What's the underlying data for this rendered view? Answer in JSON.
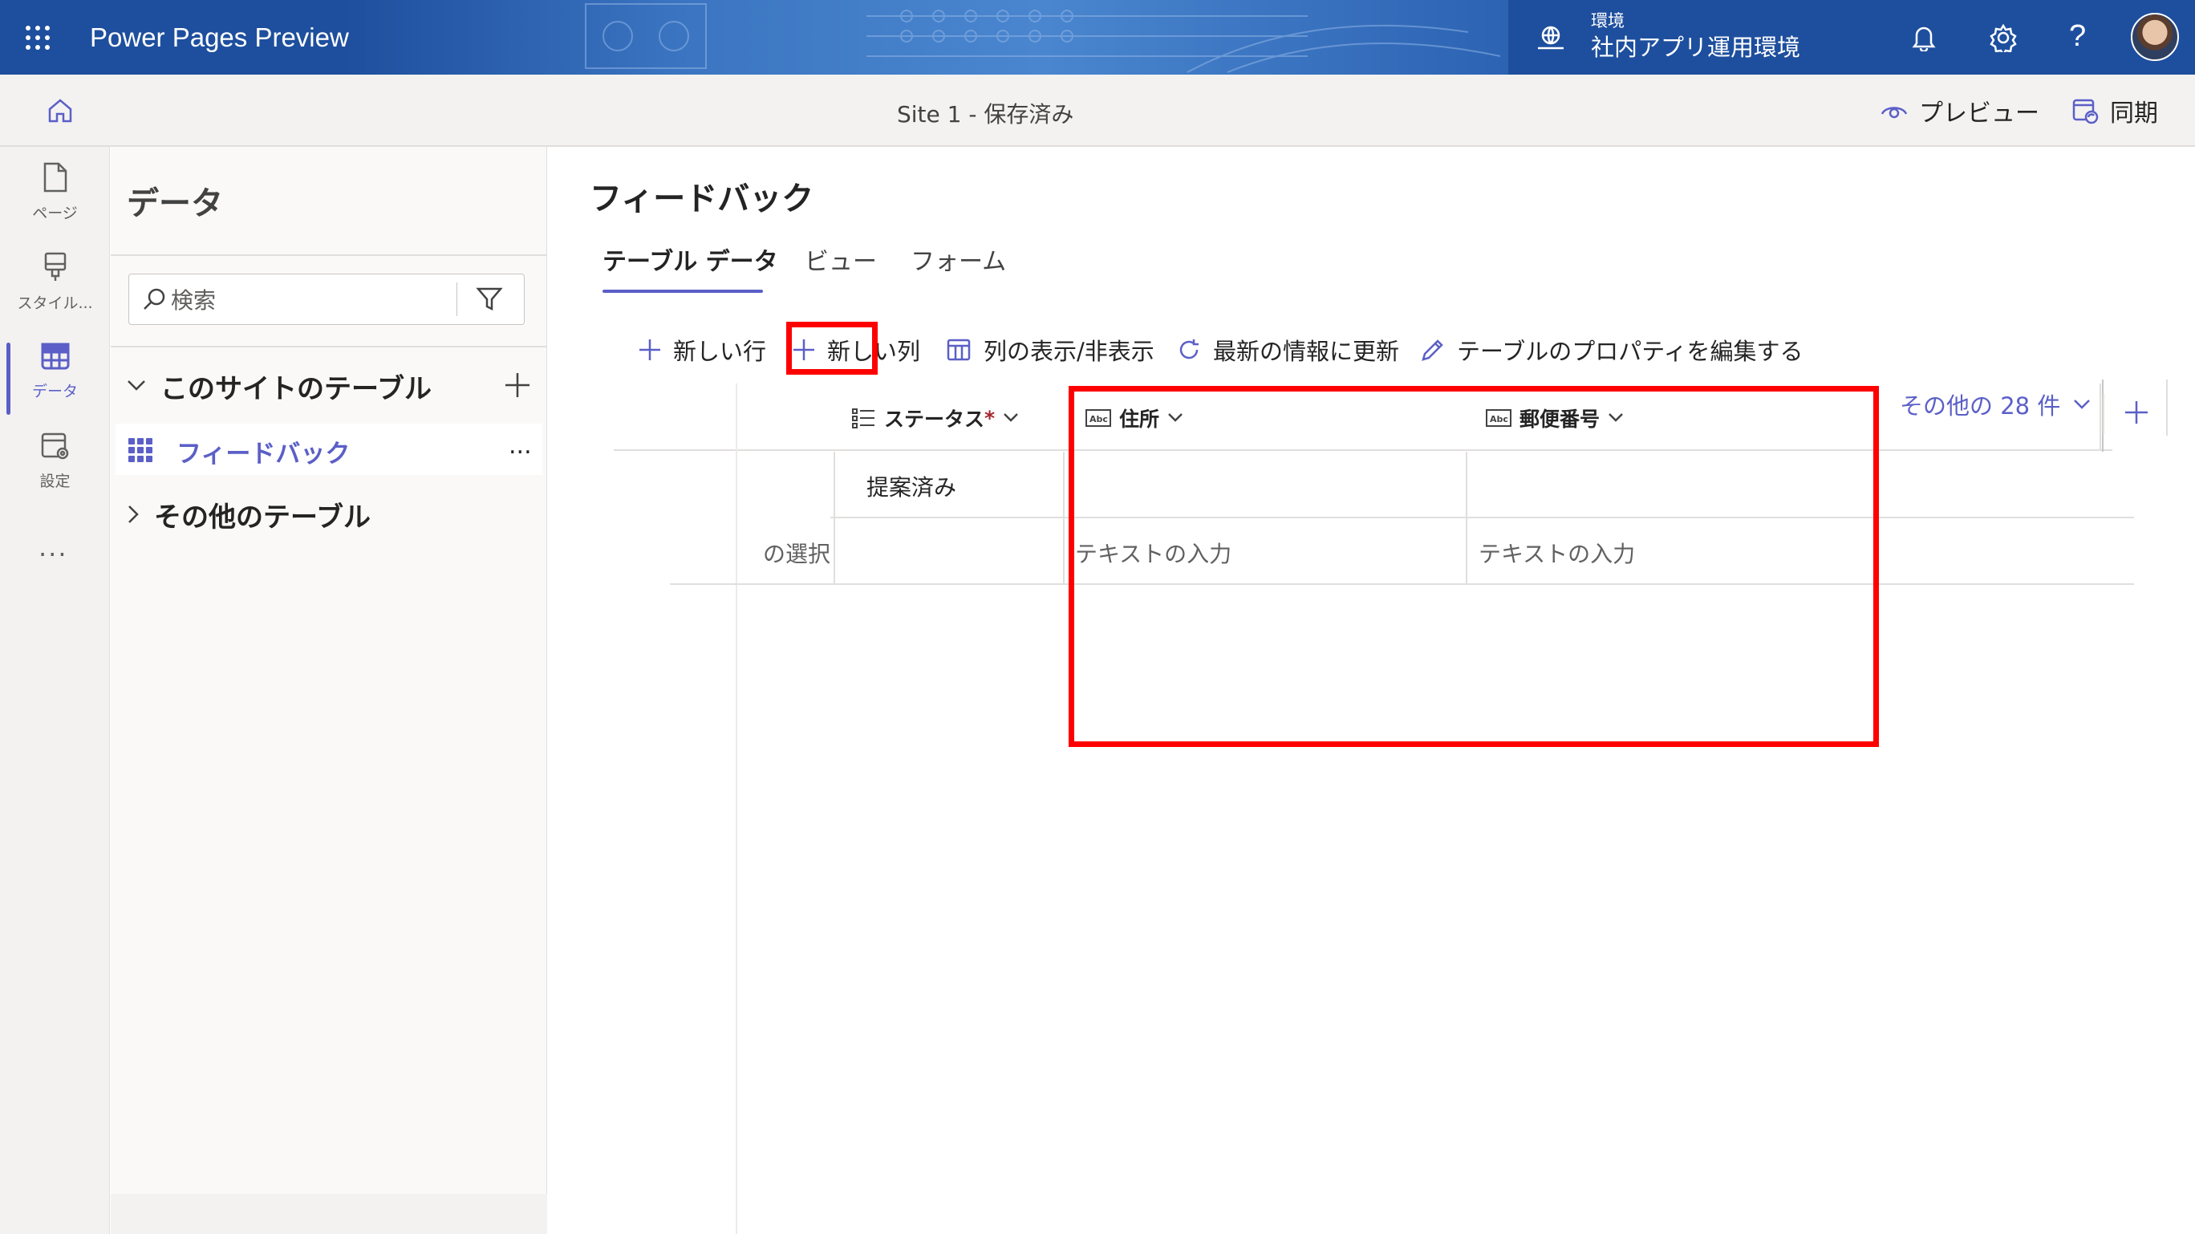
{
  "header": {
    "app_name": "Power Pages Preview",
    "env_label": "環境",
    "env_name": "社内アプリ運用環境"
  },
  "cmdbar": {
    "site_status": "Site 1 - 保存済み",
    "preview_label": "プレビュー",
    "sync_label": "同期"
  },
  "rail": {
    "items": [
      {
        "label": "ページ",
        "icon": "page-icon"
      },
      {
        "label": "スタイル...",
        "icon": "paintbrush-icon"
      },
      {
        "label": "データ",
        "icon": "table-icon",
        "active": true
      },
      {
        "label": "設定",
        "icon": "settings-icon"
      }
    ],
    "more": "..."
  },
  "data_panel": {
    "title": "データ",
    "search_placeholder": "検索",
    "section_site_tables": "このサイトのテーブル",
    "site_tables": [
      "フィードバック"
    ],
    "more_menu": "...",
    "section_other_tables": "その他のテーブル"
  },
  "main": {
    "title": "フィードバック",
    "tabs": [
      {
        "label": "テーブル データ",
        "active": true
      },
      {
        "label": "ビュー",
        "active": false
      },
      {
        "label": "フォーム",
        "active": false
      }
    ],
    "toolbar": {
      "new_row": "新しい行",
      "new_column": "新しい列",
      "show_hide_columns": "列の表示/非表示",
      "refresh": "最新の情報に更新",
      "edit_properties": "テーブルのプロパティを編集する"
    },
    "grid": {
      "columns": [
        {
          "label": "ステータス",
          "required_mark": "*",
          "icon": "choice-list-icon"
        },
        {
          "label": "住所",
          "icon": "text-abc-icon"
        },
        {
          "label": "郵便番号",
          "icon": "text-abc-icon"
        }
      ],
      "more_columns": "その他の 28 件",
      "rows": [
        {
          "status": "提案済み",
          "address": "",
          "postal": ""
        }
      ],
      "new_row": {
        "choice_placeholder": "の選択",
        "text_placeholder_address": "テキストの入力",
        "text_placeholder_postal": "テキストの入力"
      }
    }
  },
  "colors": {
    "accent": "#5b5fc7",
    "header_bg": "#1e4f9e",
    "highlight": "#ff0000"
  }
}
